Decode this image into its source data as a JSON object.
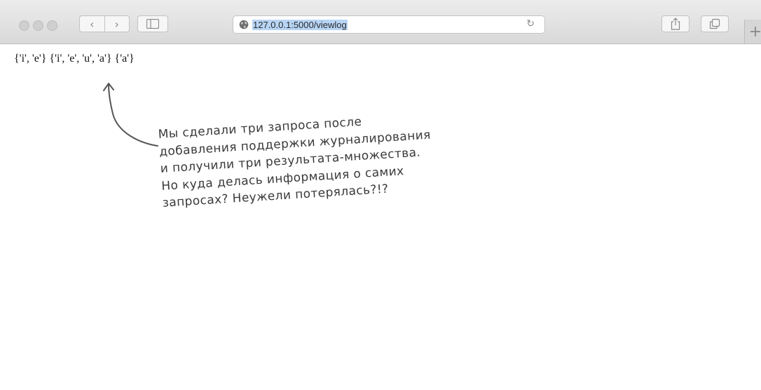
{
  "toolbar": {
    "back_icon": "‹",
    "forward_icon": "›",
    "address": {
      "url": "127.0.0.1:5000/viewlog"
    },
    "newtab_icon": "+"
  },
  "page": {
    "output_text": "{'i', 'e'} {'i', 'e', 'u', 'a'} {'a'}"
  },
  "annotation": {
    "lines": [
      "Мы сделали три запроса после",
      "добавления поддержки журналирования",
      "и получили три результата-множества.",
      "Но куда делась информация о самих",
      "запросах? Неужели потерялась?!?"
    ]
  }
}
